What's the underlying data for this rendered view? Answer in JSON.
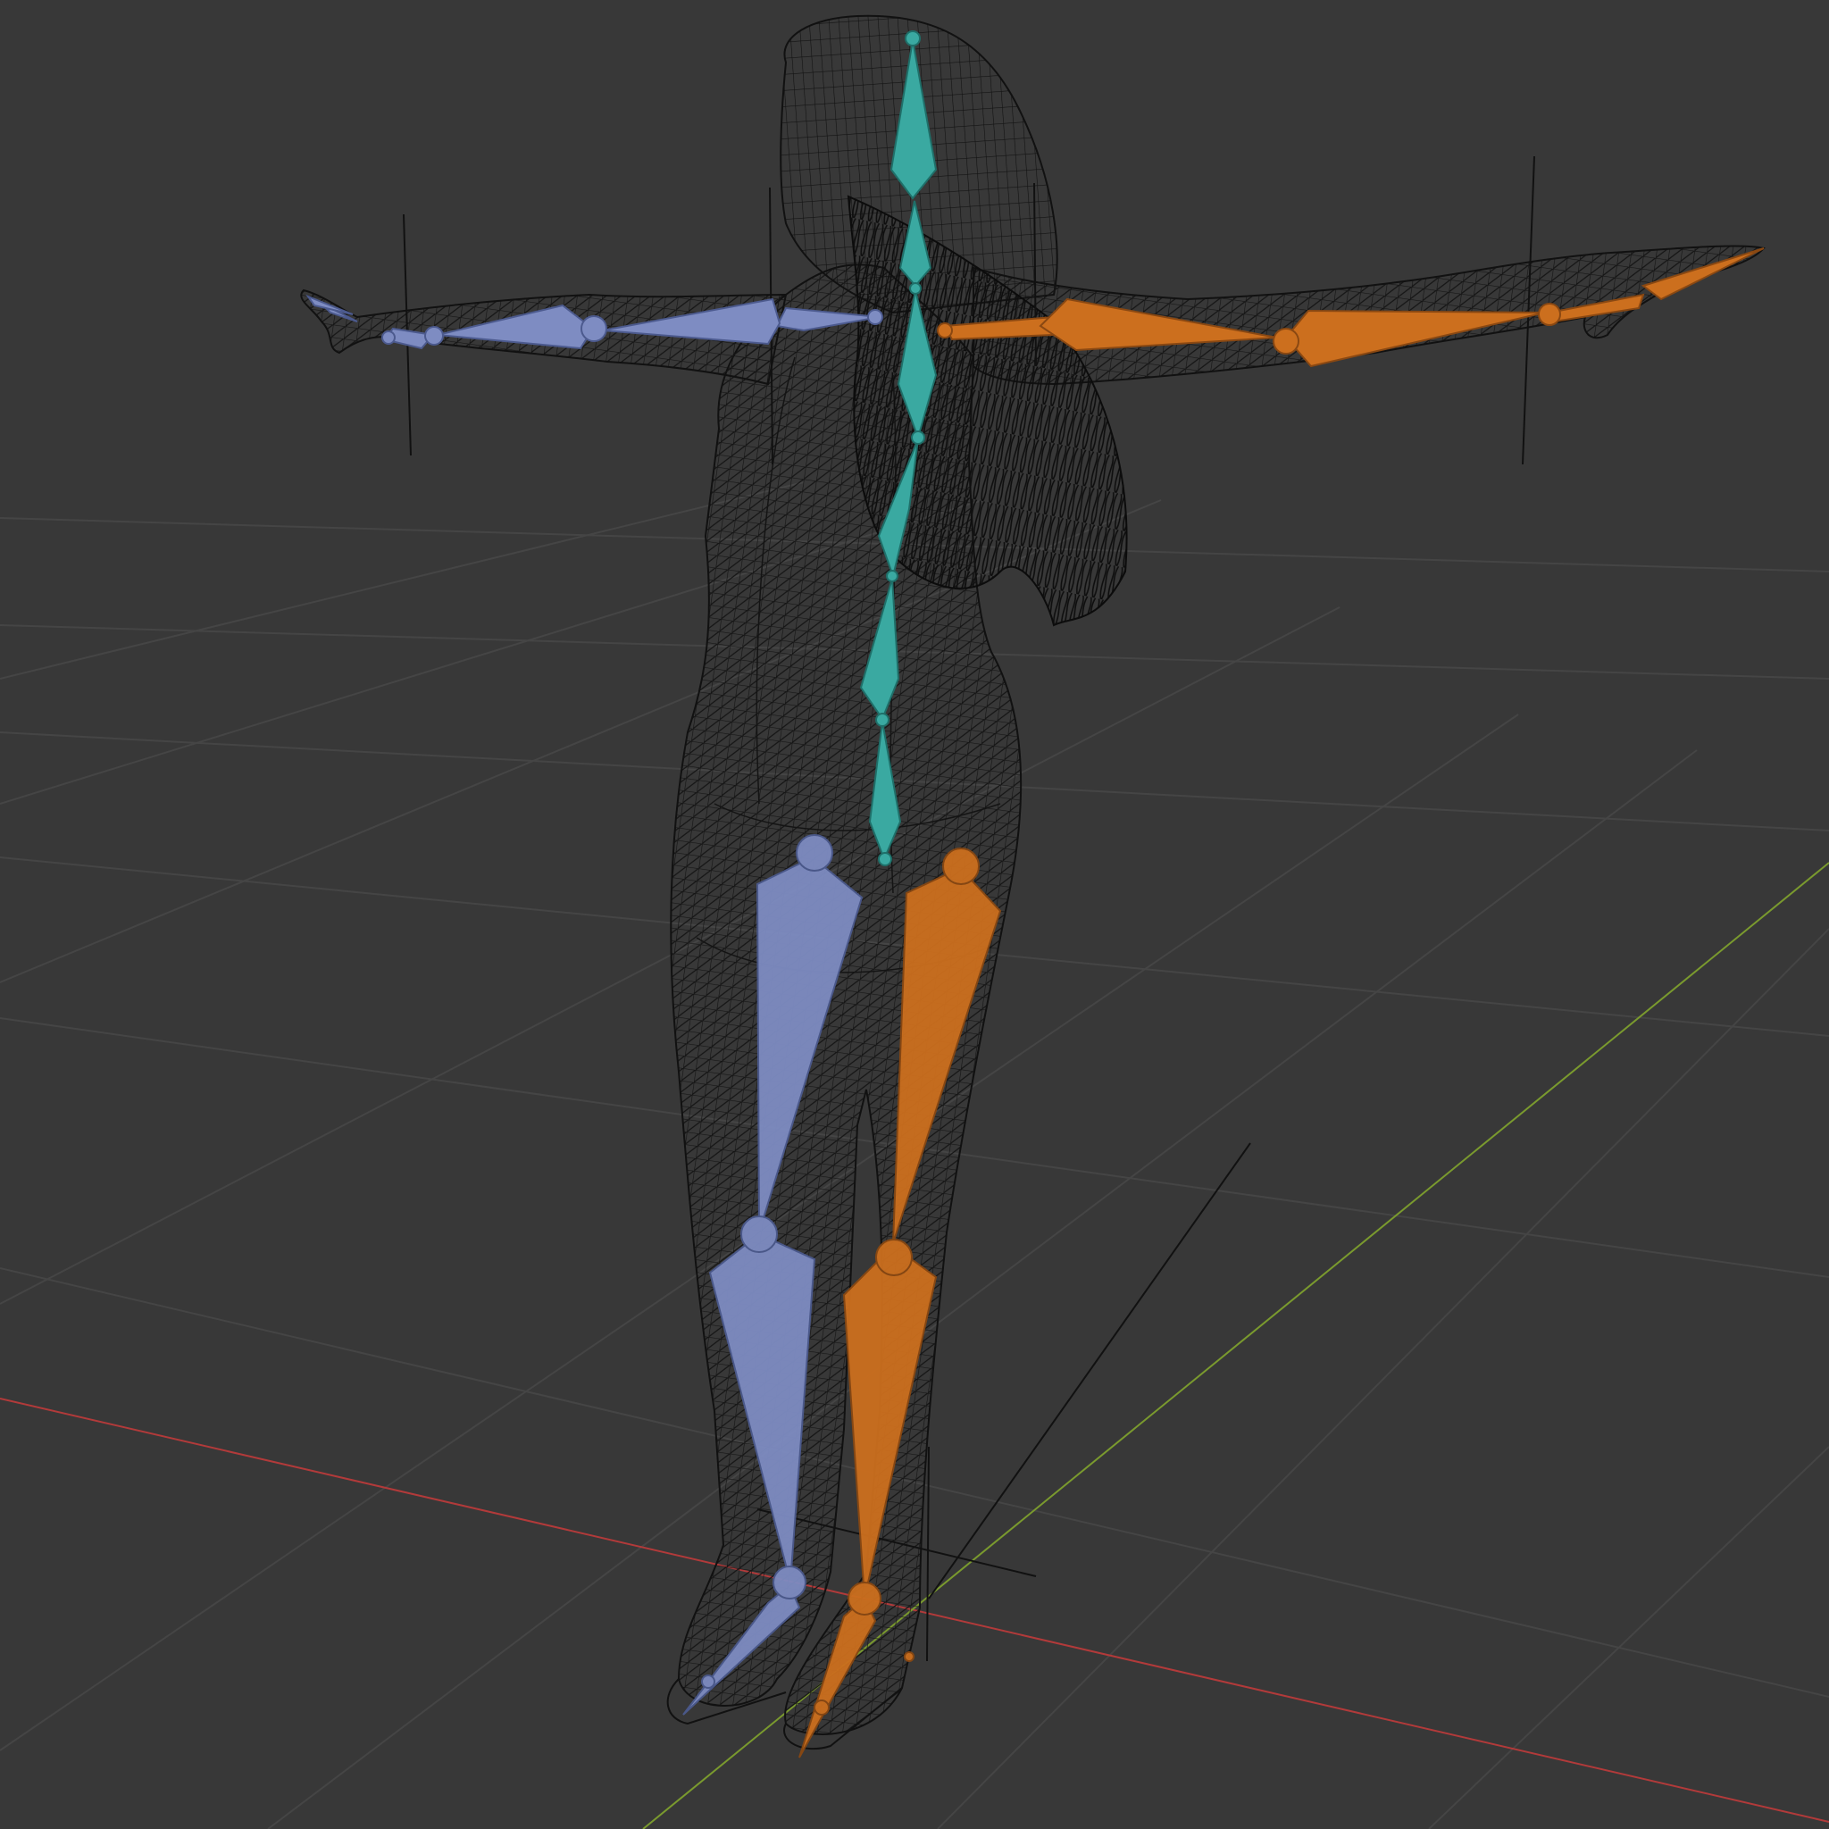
{
  "viewport": {
    "name": "3D viewport",
    "background": "#383838",
    "shading_mode": "wireframe",
    "grid": true,
    "axis_colors": {
      "x_axis": "#b23a3a",
      "y_axis": "#7a9a2e"
    }
  },
  "armature": {
    "colors": {
      "center_chain": "#3aa9a1",
      "left_side": "#7e8cc2",
      "right_side": "#cc6f1e"
    },
    "bone_groups": [
      "spine_head",
      "left_arm",
      "right_arm",
      "left_leg",
      "right_leg",
      "left_foot",
      "right_foot"
    ]
  },
  "mesh": {
    "display": "wireframe",
    "wire_color": "#111111"
  }
}
